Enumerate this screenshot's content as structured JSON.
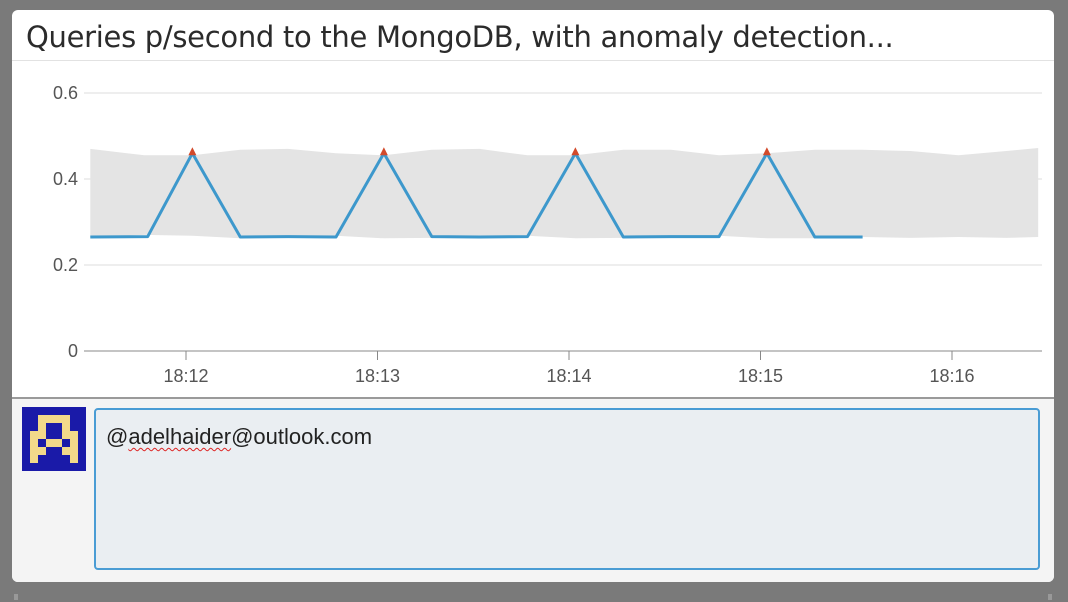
{
  "panel": {
    "title": "Queries p/second to the MongoDB, with anomaly detection..."
  },
  "chart_data": {
    "type": "line",
    "ylim": [
      0,
      0.6
    ],
    "yticks": [
      "0",
      "0.2",
      "0.4",
      "0.6"
    ],
    "xticks": [
      "18:12",
      "18:13",
      "18:14",
      "18:15",
      "18:16"
    ],
    "grid": true,
    "series": [
      {
        "color": "#3d98cc",
        "x": [
          "18:11:30",
          "18:11:48",
          "18:12:02",
          "18:12:17",
          "18:12:32",
          "18:12:47",
          "18:13:02",
          "18:13:17",
          "18:13:32",
          "18:13:47",
          "18:14:02",
          "18:14:17",
          "18:14:32",
          "18:14:47",
          "18:15:02",
          "18:15:17",
          "18:15:32"
        ],
        "values": [
          0.265,
          0.266,
          0.46,
          0.265,
          0.266,
          0.265,
          0.46,
          0.266,
          0.265,
          0.266,
          0.46,
          0.265,
          0.266,
          0.266,
          0.46,
          0.265,
          0.265
        ]
      }
    ],
    "band": {
      "color": "#e4e4e4",
      "x": [
        "18:11:30",
        "18:11:47",
        "18:12:02",
        "18:12:17",
        "18:12:32",
        "18:12:47",
        "18:13:02",
        "18:13:17",
        "18:13:32",
        "18:13:47",
        "18:14:02",
        "18:14:17",
        "18:14:32",
        "18:14:47",
        "18:15:02",
        "18:15:17",
        "18:15:32",
        "18:15:47",
        "18:16:02",
        "18:16:17",
        "18:16:27"
      ],
      "upper": [
        0.47,
        0.455,
        0.455,
        0.468,
        0.47,
        0.46,
        0.455,
        0.468,
        0.47,
        0.455,
        0.455,
        0.468,
        0.468,
        0.455,
        0.46,
        0.468,
        0.468,
        0.465,
        0.455,
        0.465,
        0.472
      ],
      "lower": [
        0.265,
        0.27,
        0.268,
        0.262,
        0.265,
        0.268,
        0.262,
        0.263,
        0.262,
        0.268,
        0.262,
        0.263,
        0.263,
        0.268,
        0.262,
        0.262,
        0.265,
        0.263,
        0.265,
        0.263,
        0.265
      ]
    },
    "anomalies": {
      "color": "#d24a2b",
      "x": [
        "18:12:02",
        "18:13:02",
        "18:14:02",
        "18:15:02"
      ],
      "values": [
        0.46,
        0.46,
        0.46,
        0.46
      ]
    }
  },
  "comment": {
    "text_before": "@",
    "misspelled": "adelhaider",
    "text_after": "@outlook.com"
  },
  "avatar": {
    "bg_color": "#1a1aa8",
    "fg_color": "#f2d98a"
  }
}
